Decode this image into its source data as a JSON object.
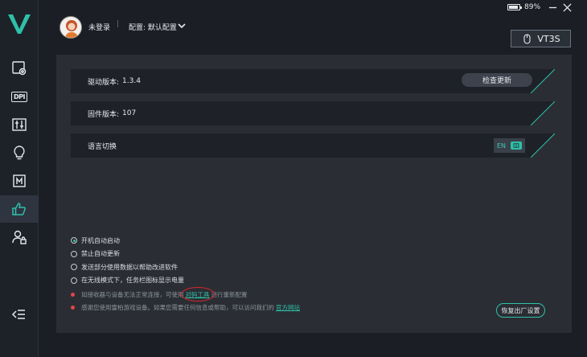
{
  "window": {
    "battery_percent": "89%",
    "battery_level": 0.89,
    "minimize_icon": "minimize-icon",
    "close_icon": "close-icon"
  },
  "header": {
    "user_status": "未登录",
    "separator": "|",
    "profile_label": "配置: 默认配置",
    "device_name": "VT3S"
  },
  "sidebar": {
    "items": [
      {
        "name": "performance",
        "icon": "mouse-settings-icon"
      },
      {
        "name": "dpi",
        "icon": "dpi-icon",
        "text": "DPI"
      },
      {
        "name": "buttons",
        "icon": "sliders-icon"
      },
      {
        "name": "lighting",
        "icon": "bulb-icon"
      },
      {
        "name": "macro",
        "icon": "macro-icon",
        "text": "M"
      },
      {
        "name": "settings",
        "icon": "thumbs-up-icon",
        "active": true
      },
      {
        "name": "account",
        "icon": "user-lock-icon"
      }
    ],
    "collapse_icon": "collapse-icon"
  },
  "settings": {
    "driver_label": "驱动版本:",
    "driver_version": "1.3.4",
    "check_update": "检查更新",
    "firmware_label": "固件版本:",
    "firmware_version": "107",
    "language_label": "语言切换",
    "language_value": "EN"
  },
  "options": [
    {
      "label": "开机自动启动",
      "checked": true
    },
    {
      "label": "禁止自动更新",
      "checked": false
    },
    {
      "label": "发送部分使用数据以帮助改进软件",
      "checked": false
    },
    {
      "label": "在无线模式下，任务栏图标显示电量",
      "checked": false
    }
  ],
  "notes": {
    "note1_before": "如接收器与设备无法正常连接，可使用",
    "note1_link": "对码工具",
    "note1_after": "进行重新配置",
    "note2_before": "感谢您使用雷柏游戏设备。如果您需要任何信息或帮助，可以访问我们的",
    "note2_link": "官方网站"
  },
  "reset_button": "恢复出厂设置",
  "colors": {
    "accent": "#2fc0a9",
    "danger": "#e2464a"
  }
}
